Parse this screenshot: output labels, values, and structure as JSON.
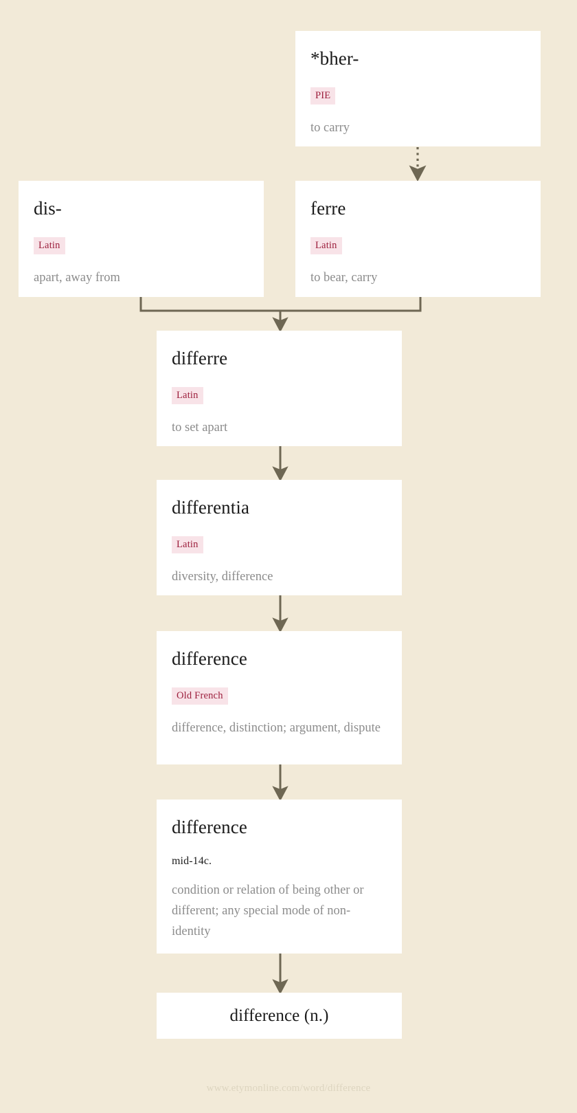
{
  "page": {
    "background_color": "#f2ead8",
    "card_color": "#ffffff",
    "badge_bg_color": "#f8e3e8",
    "badge_text_color": "#9c1e3c",
    "gloss_color": "#8c8c8c",
    "connector_color": "#6e6753",
    "footer_color": "#ddd5c0"
  },
  "nodes": {
    "pie": {
      "headword": "*bher-",
      "language": "PIE",
      "gloss": "to carry"
    },
    "dis": {
      "headword": "dis-",
      "language": "Latin",
      "gloss": "apart, away from"
    },
    "ferre": {
      "headword": "ferre",
      "language": "Latin",
      "gloss": "to bear, carry"
    },
    "differre": {
      "headword": "differre",
      "language": "Latin",
      "gloss": "to set apart"
    },
    "differentia": {
      "headword": "differentia",
      "language": "Latin",
      "gloss": "diversity, difference"
    },
    "old_french": {
      "headword": "difference",
      "language": "Old French",
      "gloss": "difference, distinction; argument, dispute"
    },
    "english": {
      "headword": "difference",
      "date": "mid-14c.",
      "gloss": "condition or relation of being other or different; any special mode of non-identity"
    },
    "final": {
      "headword": "difference (n.)"
    }
  },
  "footer": {
    "url": "www.etymonline.com/word/difference"
  }
}
